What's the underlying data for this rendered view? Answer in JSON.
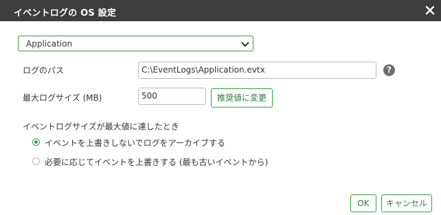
{
  "dialog": {
    "title": "イベントログの OS 設定"
  },
  "log_select": {
    "selected": "Application"
  },
  "log_path": {
    "label": "ログのパス",
    "value": "C:\\EventLogs\\Application.evtx",
    "help_glyph": "?"
  },
  "max_size": {
    "label": "最大ログサイズ (MB)",
    "value": "500",
    "recommend_button": "推奨値に変更"
  },
  "on_max": {
    "heading": "イベントログサイズが最大値に達したとき",
    "options": [
      {
        "label": "イベントを上書きしないでログをアーカイブする",
        "checked": true
      },
      {
        "label": "必要に応じてイベントを上書きする (最も古いイベントから)",
        "checked": false
      }
    ]
  },
  "footer": {
    "ok": "OK",
    "cancel": "キャンセル"
  },
  "colors": {
    "accent": "#2f9e48",
    "titlebar": "#3d3d3d"
  }
}
